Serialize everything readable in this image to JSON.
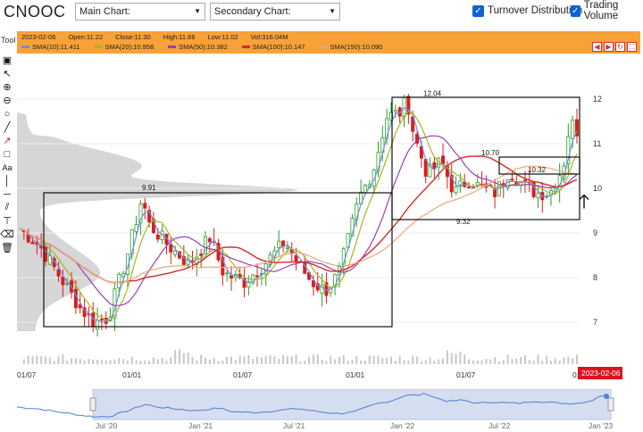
{
  "header": {
    "ticker": "CNOOC",
    "main_chart": "Main Chart:",
    "secondary_chart": "Secondary Chart:",
    "turnover": "Turnover Distribution",
    "trading_volume": "Trading Volume",
    "tool": "Tool"
  },
  "info": {
    "date": "2023-02-06",
    "open": "Open:11.22",
    "close": "Close:11.30",
    "high": "High:11.66",
    "low": "Low:11.02",
    "vol": "Vol:316.04M",
    "sma": [
      {
        "label": "SMA(10):11.411",
        "color": "#6f8fd8"
      },
      {
        "label": "SMA(20):10.958",
        "color": "#a6b522"
      },
      {
        "label": "SMA(50):10.382",
        "color": "#9b3fb6"
      },
      {
        "label": "SMA(100):10.147",
        "color": "#d42a2a"
      },
      {
        "label": "SMA(150):10.090",
        "color": "#f2a27a"
      }
    ]
  },
  "chart_data": {
    "type": "candlestick",
    "y_ticks": [
      "12",
      "11",
      "10",
      "9",
      "8",
      "7"
    ],
    "ylim": [
      6.6,
      12.6
    ],
    "x_ticks": [
      "01/07",
      "01/01",
      "01/07",
      "01/01",
      "01/07",
      "01"
    ],
    "current_date_badge": "2023-02-06",
    "annotations": [
      "9.91",
      "12.04",
      "10.70",
      "10.32",
      "9.32"
    ],
    "boxes": [
      {
        "from": "2020-07",
        "to": "2022-01",
        "low": 6.9,
        "high": 9.9
      },
      {
        "from": "2022-01",
        "to": "2023-02",
        "low": 9.3,
        "high": 12.04
      },
      {
        "from": "2022-08",
        "to": "2023-02",
        "low": 10.32,
        "high": 10.7
      }
    ],
    "navigator_ticks": [
      "Jul '20",
      "Jan '21",
      "Jul '21",
      "Jan '22",
      "Jul '22",
      "Jan '23"
    ]
  }
}
